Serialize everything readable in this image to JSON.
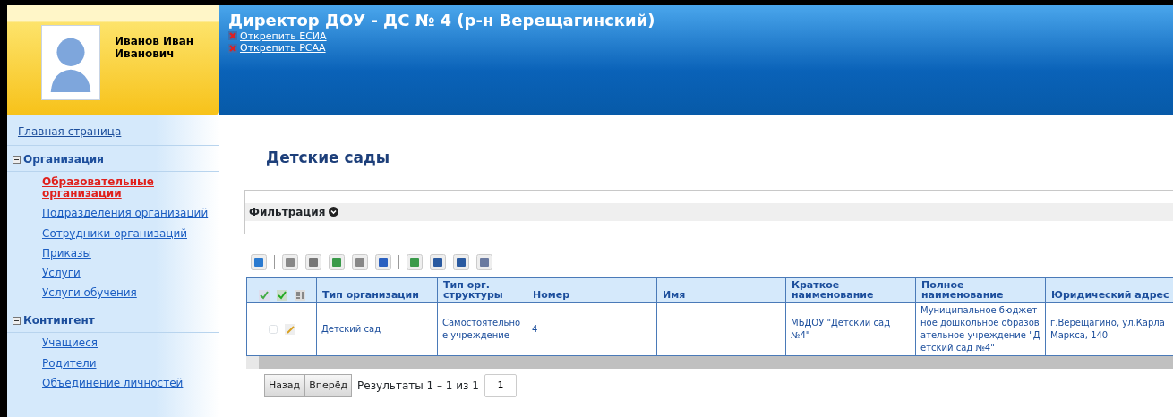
{
  "user": {
    "name": "Иванов Иван Иванович"
  },
  "header": {
    "title": "Директор ДОУ - ДС № 4 (р-н Верещагинский)",
    "links": [
      "Открепить ЕСИА",
      "Открепить РСАА"
    ]
  },
  "sidebar": {
    "home": "Главная страница",
    "sections": [
      {
        "title": "Организация",
        "expanded": true,
        "items": [
          {
            "label": "Образовательные организации",
            "selected": true
          },
          {
            "label": "Подразделения организаций",
            "selected": false
          },
          {
            "label": "Сотрудники организаций",
            "selected": false
          },
          {
            "label": "Приказы",
            "selected": false
          },
          {
            "label": "Услуги",
            "selected": false
          },
          {
            "label": "Услуги обучения",
            "selected": false
          }
        ]
      },
      {
        "title": "Контингент",
        "expanded": true,
        "items": [
          {
            "label": "Учащиеся",
            "selected": false
          },
          {
            "label": "Родители",
            "selected": false
          },
          {
            "label": "Объединение личностей",
            "selected": false
          }
        ]
      }
    ]
  },
  "page": {
    "title": "Детские сады",
    "filter": {
      "label": "Фильтрация",
      "expanded": false
    }
  },
  "table": {
    "columns": [
      "Тип организации",
      "Тип орг. структуры",
      "Номер",
      "Имя",
      "Краткое наименование",
      "Полное наименование",
      "Юридический адрес"
    ],
    "rows": [
      {
        "checked": false,
        "cells": [
          "Детский сад",
          "Самостоятельное учреждение",
          "4",
          "",
          "МБДОУ \"Детский сад №4\"",
          "Муниципальное бюджетное дошкольное образовательное учреждение \"Детский сад №4\"",
          "г.Верещагино, ул.Карла Маркса, 140"
        ]
      }
    ]
  },
  "pager": {
    "prev": "Назад",
    "next": "Вперёд",
    "summary": "Результаты 1 – 1 из 1",
    "page": "1"
  }
}
